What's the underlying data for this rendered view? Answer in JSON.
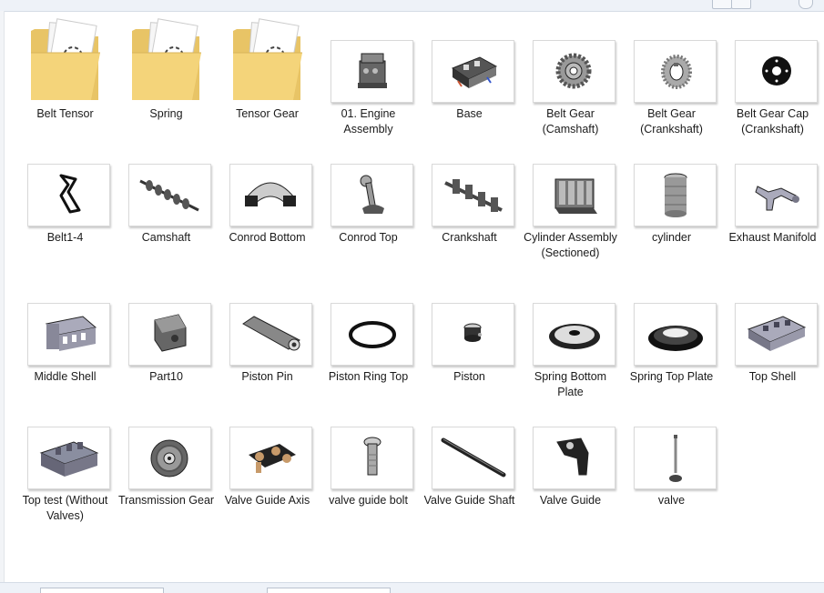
{
  "files": [
    {
      "name": "Belt Tensor",
      "kind": "folder"
    },
    {
      "name": "Spring",
      "kind": "folder"
    },
    {
      "name": "Tensor Gear",
      "kind": "folder"
    },
    {
      "name": "01. Engine Assembly",
      "kind": "part",
      "icon": "engine-assembly-icon"
    },
    {
      "name": "Base",
      "kind": "part",
      "icon": "base-icon"
    },
    {
      "name": "Belt Gear (Camshaft)",
      "kind": "part",
      "icon": "camshaft-gear-icon"
    },
    {
      "name": "Belt Gear (Crankshaft)",
      "kind": "part",
      "icon": "crankshaft-gear-icon"
    },
    {
      "name": "Belt Gear Cap (Crankshaft)",
      "kind": "part",
      "icon": "gear-cap-icon"
    },
    {
      "name": "Belt1-4",
      "kind": "part",
      "icon": "belt-icon"
    },
    {
      "name": "Camshaft",
      "kind": "part",
      "icon": "camshaft-icon"
    },
    {
      "name": "Conrod Bottom",
      "kind": "part",
      "icon": "conrod-bottom-icon"
    },
    {
      "name": "Conrod Top",
      "kind": "part",
      "icon": "conrod-top-icon"
    },
    {
      "name": "Crankshaft",
      "kind": "part",
      "icon": "crankshaft-icon"
    },
    {
      "name": "Cylinder Assembly (Sectioned)",
      "kind": "part",
      "icon": "cylinder-assembly-icon"
    },
    {
      "name": "cylinder",
      "kind": "part",
      "icon": "cylinder-icon"
    },
    {
      "name": "Exhaust Manifold",
      "kind": "part",
      "icon": "exhaust-manifold-icon"
    },
    {
      "name": "Middle Shell",
      "kind": "part",
      "icon": "middle-shell-icon"
    },
    {
      "name": "Part10",
      "kind": "part",
      "icon": "part10-icon"
    },
    {
      "name": "Piston Pin",
      "kind": "part",
      "icon": "piston-pin-icon"
    },
    {
      "name": "Piston Ring Top",
      "kind": "part",
      "icon": "piston-ring-icon"
    },
    {
      "name": "Piston",
      "kind": "part",
      "icon": "piston-icon"
    },
    {
      "name": "Spring Bottom Plate",
      "kind": "part",
      "icon": "spring-bottom-plate-icon"
    },
    {
      "name": "Spring Top Plate",
      "kind": "part",
      "icon": "spring-top-plate-icon"
    },
    {
      "name": "Top Shell",
      "kind": "part",
      "icon": "top-shell-icon"
    },
    {
      "name": "Top test (Without Valves)",
      "kind": "part",
      "icon": "top-test-icon"
    },
    {
      "name": "Transmission Gear",
      "kind": "part",
      "icon": "transmission-gear-icon"
    },
    {
      "name": "Valve Guide Axis",
      "kind": "part",
      "icon": "valve-guide-axis-icon"
    },
    {
      "name": "valve guide bolt",
      "kind": "part",
      "icon": "valve-guide-bolt-icon"
    },
    {
      "name": "Valve Guide Shaft",
      "kind": "part",
      "icon": "valve-guide-shaft-icon"
    },
    {
      "name": "Valve Guide",
      "kind": "part",
      "icon": "valve-guide-icon"
    },
    {
      "name": "valve",
      "kind": "part",
      "icon": "valve-icon"
    }
  ]
}
